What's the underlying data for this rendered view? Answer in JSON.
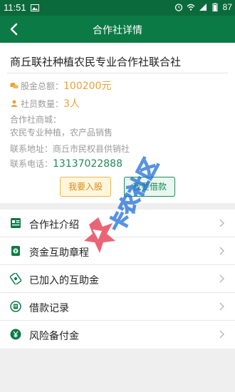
{
  "status_bar": {
    "time": "11:51",
    "battery": "87",
    "icons": [
      "image-icon",
      "alarm-icon",
      "wifi-icon",
      "signal-icon",
      "battery-icon"
    ]
  },
  "navbar": {
    "back_icon": "chevron-left-icon",
    "title": "合作社详情"
  },
  "coop": {
    "name": "商丘联社种植农民专业合作社联合社",
    "stock_label": "股金总额：",
    "stock_value": "100200元",
    "members_label": "社员数量：",
    "members_value": "3人",
    "mall_label": "合作社商城：",
    "mall_value": "农民专业种植，农产品销售",
    "address_label": "联系地址：",
    "address_value": "商丘市民权县供销社",
    "phone_label": "联系电话：",
    "phone_value": "13137022888"
  },
  "buttons": {
    "join": "我要入股",
    "borrow": "我要借款"
  },
  "menu": [
    {
      "label": "合作社介绍",
      "icon": "document-icon"
    },
    {
      "label": "资金互助章程",
      "icon": "money-icon"
    },
    {
      "label": "已加入的互助金",
      "icon": "banknote-icon"
    },
    {
      "label": "借款记录",
      "icon": "record-icon"
    },
    {
      "label": "风险备付金",
      "icon": "yen-icon"
    }
  ],
  "watermark": {
    "text": "卡农社区"
  },
  "colors": {
    "primary": "#0b7a45",
    "statusbar": "#0b6a3c",
    "accent": "#e9a23b",
    "phone": "#1f8a57"
  }
}
